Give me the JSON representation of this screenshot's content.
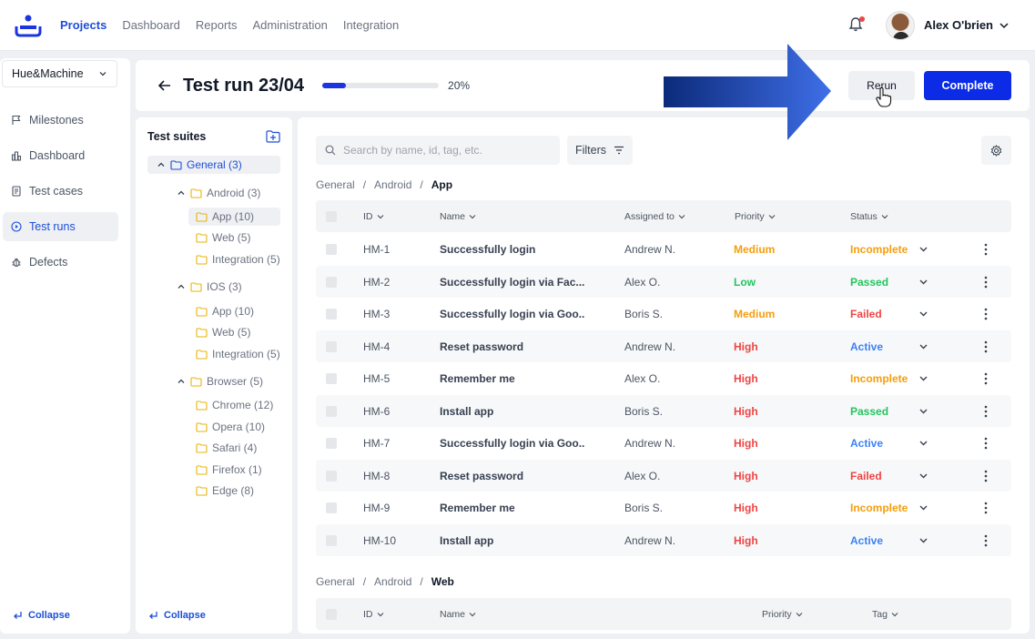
{
  "nav": {
    "links": [
      "Projects",
      "Dashboard",
      "Reports",
      "Administration",
      "Integration"
    ],
    "active_link": "Projects",
    "user_name": "Alex O'brien"
  },
  "sidebar": {
    "project": "Hue&Machine",
    "items": [
      {
        "label": "Milestones",
        "icon": "flag-icon"
      },
      {
        "label": "Dashboard",
        "icon": "chart-icon"
      },
      {
        "label": "Test cases",
        "icon": "document-icon"
      },
      {
        "label": "Test runs",
        "icon": "play-circle-icon",
        "active": true
      },
      {
        "label": "Defects",
        "icon": "bug-icon"
      }
    ],
    "collapse_label": "Collapse"
  },
  "header": {
    "title": "Test run 23/04",
    "progress_value": 0.2,
    "progress_label": "20%",
    "rerun_label": "Rerun",
    "complete_label": "Complete"
  },
  "suites": {
    "title": "Test suites",
    "tree": [
      {
        "label": "General (3)",
        "expanded": true,
        "selected": true
      },
      {
        "label": "Android (3)",
        "expanded": true
      },
      {
        "label": "App (10)",
        "selected": true
      },
      {
        "label": "Web (5)"
      },
      {
        "label": "Integration (5)"
      },
      {
        "label": "IOS (3)",
        "expanded": true
      },
      {
        "label": "App (10)"
      },
      {
        "label": "Web (5)"
      },
      {
        "label": "Integration (5)"
      },
      {
        "label": "Browser (5)",
        "expanded": true
      },
      {
        "label": "Chrome (12)"
      },
      {
        "label": "Opera (10)"
      },
      {
        "label": "Safari (4)"
      },
      {
        "label": "Firefox (1)"
      },
      {
        "label": "Edge (8)"
      }
    ],
    "collapse_label": "Collapse"
  },
  "main": {
    "search_placeholder": "Search by name, id, tag, etc.",
    "filters_label": "Filters",
    "section1": {
      "breadcrumb": [
        "General",
        "Android",
        "App"
      ],
      "separator": "/",
      "headers": {
        "id": "ID",
        "name": "Name",
        "assigned": "Assigned to",
        "priority": "Priority",
        "status": "Status"
      },
      "rows": [
        {
          "id": "HM-1",
          "name": "Successfully login",
          "assigned": "Andrew N.",
          "priority": "Medium",
          "status": "Incomplete"
        },
        {
          "id": "HM-2",
          "name": "Successfully login via Fac...",
          "assigned": "Alex O.",
          "priority": "Low",
          "status": "Passed"
        },
        {
          "id": "HM-3",
          "name": "Successfully login via Goo...",
          "assigned": "Boris S.",
          "priority": "Medium",
          "status": "Failed"
        },
        {
          "id": "HM-4",
          "name": "Reset password",
          "assigned": "Andrew N.",
          "priority": "High",
          "status": "Active"
        },
        {
          "id": "HM-5",
          "name": "Remember me",
          "assigned": "Alex O.",
          "priority": "High",
          "status": "Incomplete"
        },
        {
          "id": "HM-6",
          "name": "Install app",
          "assigned": "Boris S.",
          "priority": "High",
          "status": "Passed"
        },
        {
          "id": "HM-7",
          "name": "Successfully login via Goo...",
          "assigned": "Andrew N.",
          "priority": "High",
          "status": "Active"
        },
        {
          "id": "HM-8",
          "name": "Reset password",
          "assigned": "Alex O.",
          "priority": "High",
          "status": "Failed"
        },
        {
          "id": "HM-9",
          "name": "Remember me",
          "assigned": "Boris S.",
          "priority": "High",
          "status": "Incomplete"
        },
        {
          "id": "HM-10",
          "name": "Install app",
          "assigned": "Andrew N.",
          "priority": "High",
          "status": "Active"
        }
      ]
    },
    "section2": {
      "breadcrumb": [
        "General",
        "Android",
        "Web"
      ],
      "headers": {
        "id": "ID",
        "name": "Name",
        "priority": "Priority",
        "tag": "Tag"
      }
    }
  },
  "colors": {
    "accent": "#0b2be6",
    "medium": "#f59e0b",
    "low": "#22c55e",
    "high": "#ef4444",
    "active": "#3b82f6"
  }
}
